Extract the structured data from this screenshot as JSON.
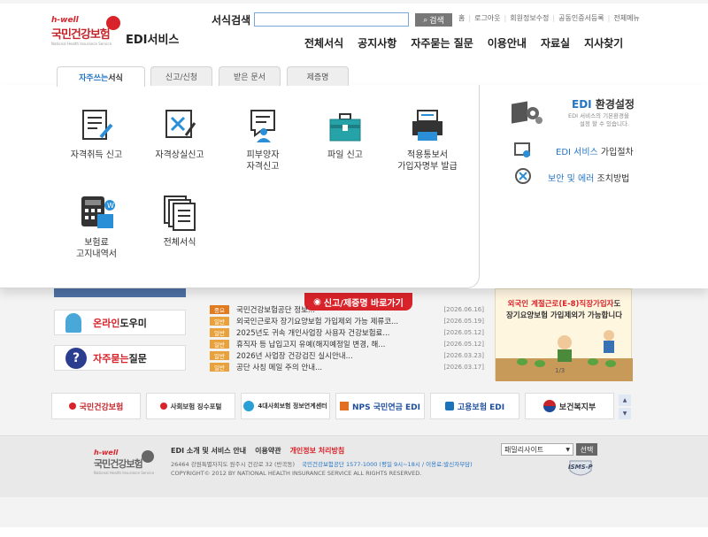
{
  "header": {
    "logo_hwell": "h-well",
    "logo_name": "국민건강보험",
    "logo_sub": "National Health Insurance Service",
    "service_title": "EDI서비스",
    "search_label": "서식검색",
    "search_value": "",
    "search_button": "검색",
    "util_menu": [
      "홈",
      "로그아웃",
      "회원정보수정",
      "공동인증서등록",
      "전체메뉴"
    ],
    "gnb": [
      "전체서식",
      "공지사항",
      "자주묻는 질문",
      "이용안내",
      "자료실",
      "지사찾기"
    ]
  },
  "tabs": [
    {
      "label_highlight": "자주쓰는",
      "label_rest": " 서식",
      "active": true
    },
    {
      "label_highlight": "",
      "label_rest": "신고/신청",
      "active": false
    },
    {
      "label_highlight": "",
      "label_rest": "받은 문서",
      "active": false
    },
    {
      "label_highlight": "",
      "label_rest": "제증명",
      "active": false
    }
  ],
  "forms": [
    {
      "line1": "자격취득 신고",
      "line2": "",
      "icon": "document-pen-icon"
    },
    {
      "line1": "자격상실신고",
      "line2": "",
      "icon": "document-x-icon"
    },
    {
      "line1": "피부양자",
      "line2": "자격신고",
      "icon": "dependent-person-icon"
    },
    {
      "line1": "파일 신고",
      "line2": "",
      "icon": "briefcase-icon"
    },
    {
      "line1": "적용통보서",
      "line2": "가입자명부 발급",
      "icon": "printer-icon"
    },
    {
      "line1": "보험료",
      "line2": "고지내역서",
      "icon": "calculator-icon"
    },
    {
      "line1": "전체서식",
      "line2": "",
      "icon": "documents-stack-icon"
    }
  ],
  "right_panel": {
    "env_title_blue": "EDI",
    "env_title_rest": " 환경설정",
    "env_desc_1": "EDI 서비스의 기본환경을",
    "env_desc_2": "설정 할 수 있습니다.",
    "join_blue": "EDI 서비스",
    "join_rest": " 가입절차",
    "security_blue": "보안 및 에러",
    "security_rest": " 조치방법"
  },
  "helpers": {
    "online_red": "온라인",
    "online_rest": " 도우미",
    "faq_red": "자주묻는",
    "faq_rest": " 질문",
    "phone": "1577-1000"
  },
  "notice_tab": "신고/제증명 바로가기",
  "notices": [
    {
      "badge": "중요",
      "color": "#e07b20",
      "title": "국민건강보험공단 정보...",
      "date": "[2026.06.16]"
    },
    {
      "badge": "일반",
      "color": "#e9a23b",
      "title": "외국인근로자 장기요양보험 가입제외 가능 제류코...",
      "date": "[2026.05.19]"
    },
    {
      "badge": "일반",
      "color": "#e9a23b",
      "title": "2025년도 귀속 개인사업장 사용자 건강보험료...",
      "date": "[2026.05.12]"
    },
    {
      "badge": "일반",
      "color": "#e9a23b",
      "title": "휴직자 등 납입고지 유예(해지예정일 변경, 해...",
      "date": "[2026.05.12]"
    },
    {
      "badge": "일반",
      "color": "#e9a23b",
      "title": "2026년 사업장 건강검진 실시안내...",
      "date": "[2026.03.23]"
    },
    {
      "badge": "일반",
      "color": "#e9a23b",
      "title": "공단 사칭 메일 주의 안내...",
      "date": "[2026.03.17]"
    }
  ],
  "banner": {
    "line1_red": "외국인 계절근로(E-8)직장가입자",
    "line1_rest": "도",
    "line2": "장기요양보험 가입제외가 가능합니다",
    "pager": "1/3"
  },
  "partners": [
    {
      "text": "국민건강보험",
      "icon": "nhis-logo-icon"
    },
    {
      "text": "사회보험 징수포털",
      "icon": "nhis-logo-icon"
    },
    {
      "text": "4대사회보험 정보연계센터",
      "icon": "social-insurance-icon"
    },
    {
      "text": "NPS 국민연금 EDI",
      "icon": "nps-logo-icon"
    },
    {
      "text": "고용보험 EDI",
      "icon": "employment-logo-icon"
    },
    {
      "text": "보건복지부",
      "icon": "mohw-logo-icon"
    }
  ],
  "footer": {
    "links": [
      "EDI 소개 및 서비스 안내",
      "이용약관",
      "개인정보 처리방침"
    ],
    "address": "26464 강원특별자치도 원주시 건강로 32 (반곡동)",
    "contact": "국민건강보험공단 1577-1000 (평일 9시~18시 / 이용료:발신자부담)",
    "copyright": "COPYRIGHT© 2012 BY NATIONAL HEALTH INSURANCE SERVICE ALL RIGHTS RESERVED.",
    "family_select": "패밀리사이트",
    "family_button": "선택",
    "isms": "ISMS-P"
  },
  "colors": {
    "brand_red": "#d8232a",
    "accent_blue": "#2575c5",
    "notice_red": "#d9232a"
  }
}
